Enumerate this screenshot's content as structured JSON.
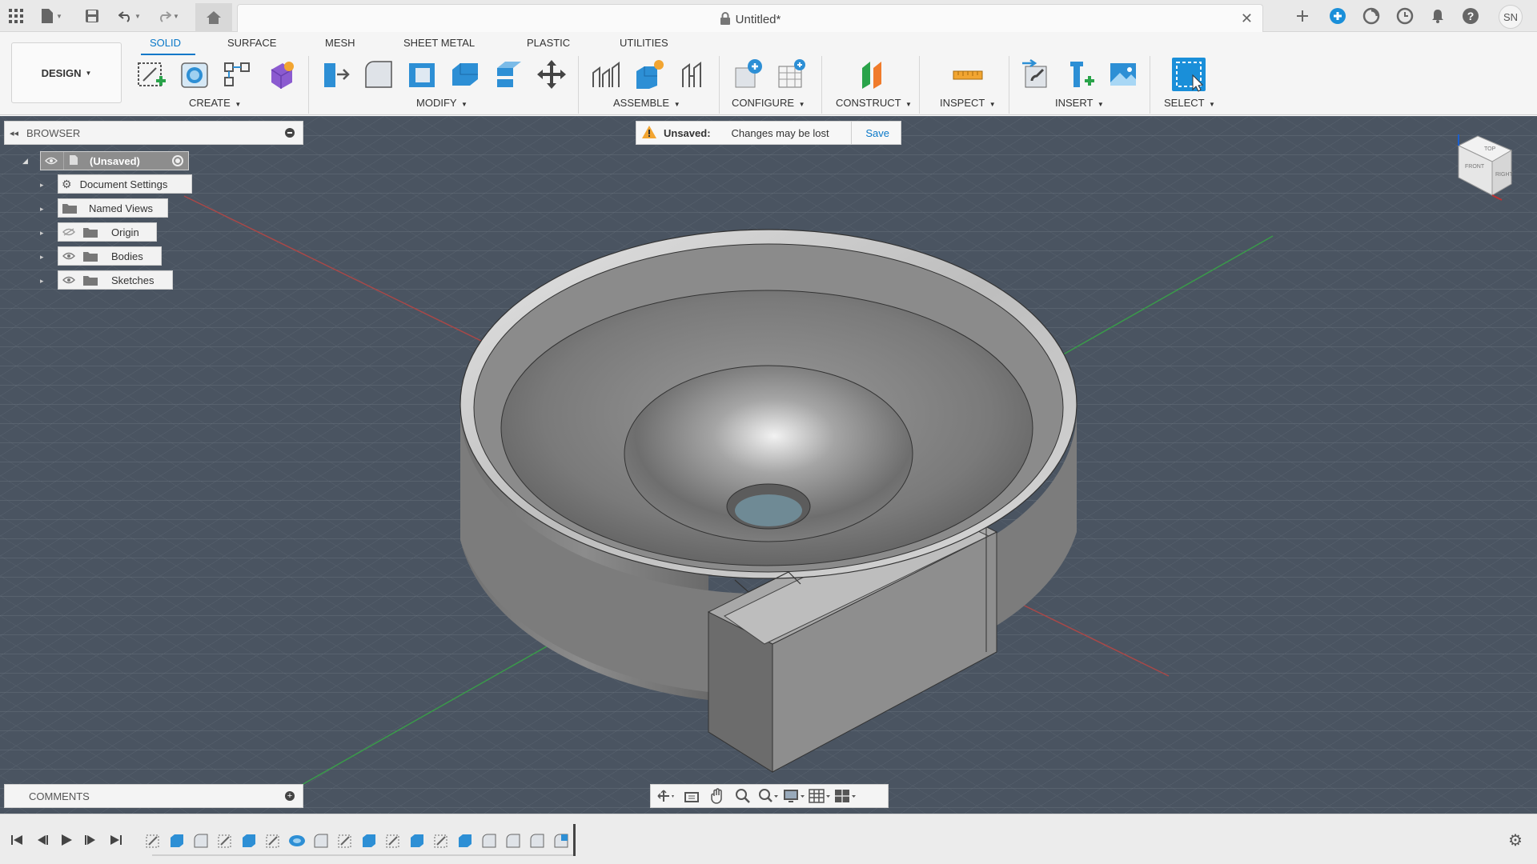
{
  "window": {
    "doc_title": "Untitled*",
    "user_initials": "SN"
  },
  "toolbar": {
    "workspace": "DESIGN",
    "tabs": [
      {
        "label": "SOLID",
        "active": true
      },
      {
        "label": "SURFACE"
      },
      {
        "label": "MESH"
      },
      {
        "label": "SHEET METAL"
      },
      {
        "label": "PLASTIC"
      },
      {
        "label": "UTILITIES"
      }
    ],
    "groups": [
      {
        "label": "CREATE"
      },
      {
        "label": "MODIFY"
      },
      {
        "label": "ASSEMBLE"
      },
      {
        "label": "CONFIGURE"
      },
      {
        "label": "CONSTRUCT"
      },
      {
        "label": "INSPECT"
      },
      {
        "label": "INSERT"
      },
      {
        "label": "SELECT"
      }
    ]
  },
  "browser": {
    "title": "BROWSER",
    "root": "(Unsaved)",
    "items": [
      {
        "label": "Document Settings",
        "icon": "gear-icon"
      },
      {
        "label": "Named Views",
        "icon": "folder-icon"
      },
      {
        "label": "Origin",
        "icon": "folder-icon",
        "hidden": true
      },
      {
        "label": "Bodies",
        "icon": "folder-icon"
      },
      {
        "label": "Sketches",
        "icon": "folder-icon"
      }
    ]
  },
  "banner": {
    "status": "Unsaved:",
    "message": "Changes may be lost",
    "action": "Save"
  },
  "comments": {
    "title": "COMMENTS"
  },
  "viewcube": {
    "faces": [
      "TOP",
      "FRONT",
      "RIGHT"
    ]
  },
  "colors": {
    "accent": "#0a78c8",
    "viewport_bg": "#4a5461",
    "grid_line": "#6c7580",
    "axis_x": "#b04545",
    "axis_y": "#3e9a4e",
    "model_body": "#8a8a8a"
  }
}
